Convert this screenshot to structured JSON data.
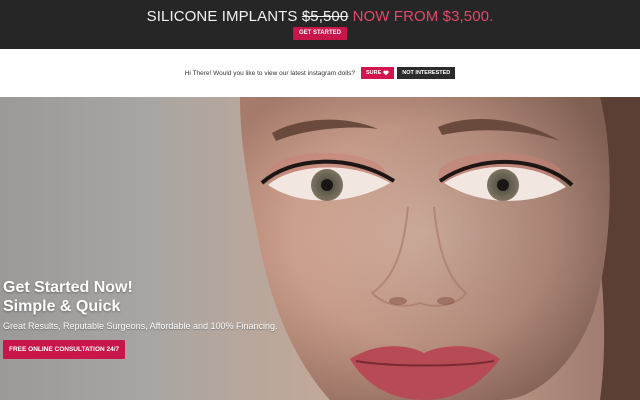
{
  "promo": {
    "prefix": "SILICONE IMPLANTS",
    "old_price": "$5,500",
    "offer": "NOW FROM $3,500.",
    "button_label": "GET STARTED"
  },
  "prompt": {
    "question": "Hi There! Would you like to view our latest instagram dolls?",
    "sure_label": "SURE",
    "sure_icon": "heart-icon",
    "not_interested_label": "NOT INTERESTED"
  },
  "hero": {
    "heading_line1": "Get Started Now!",
    "heading_line2": "Simple & Quick",
    "subtext": "Great Results, Reputable Surgeons, Affordable and 100% Financing.",
    "cta_label": "FREE ONLINE CONSULTATION 24/7"
  },
  "colors": {
    "accent": "#c8154a",
    "promo_background": "#262626",
    "promo_accent_text": "#e5486c"
  }
}
